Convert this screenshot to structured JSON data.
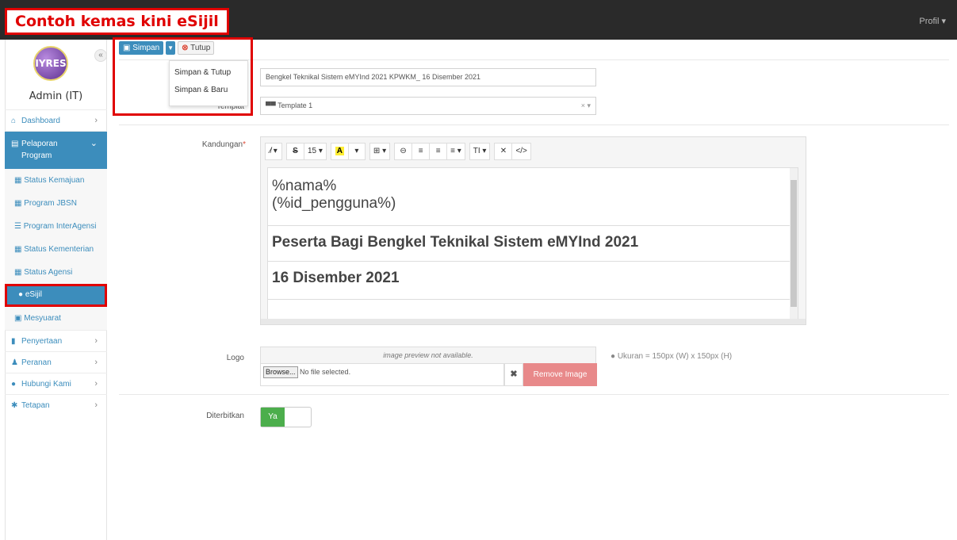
{
  "caption": "Contoh kemas kini eSijil",
  "topbar": {
    "profile": "Profil ▾"
  },
  "sidebar": {
    "collapse": "«",
    "logo_text": "IYRES",
    "admin": "Admin (IT)",
    "items": [
      {
        "label": "Dashboard",
        "icon": "home-icon"
      },
      {
        "label": "Pelaporan Program",
        "icon": "report-icon"
      },
      {
        "label": "Penyertaan",
        "icon": "clipboard-icon"
      },
      {
        "label": "Peranan",
        "icon": "user-icon"
      },
      {
        "label": "Hubungi Kami",
        "icon": "chat-icon"
      },
      {
        "label": "Tetapan",
        "icon": "gear-icon"
      }
    ],
    "sub_items": [
      {
        "label": "Status Kemajuan",
        "icon": "table-icon"
      },
      {
        "label": "Program JBSN",
        "icon": "table-icon"
      },
      {
        "label": "Program InterAgensi",
        "icon": "list-icon"
      },
      {
        "label": "Status Kementerian",
        "icon": "table-icon"
      },
      {
        "label": "Status Agensi",
        "icon": "table-icon"
      },
      {
        "label": "eSijil",
        "icon": "circle-icon"
      },
      {
        "label": "Mesyuarat",
        "icon": "calendar-icon"
      }
    ]
  },
  "toolbar": {
    "simpan": "Simpan",
    "tutup": "Tutup",
    "menu": [
      "Simpan & Tutup",
      "Simpan & Baru"
    ]
  },
  "form": {
    "title_value": "Bengkel Teknikal Sistem eMYInd 2021 KPWKM_ 16 Disember 2021",
    "template_label": "Templat",
    "template_value": "Template 1",
    "template_clear": "× ▾",
    "kandungan_label": "Kandungan",
    "required_mark": "*",
    "editor_toolbar": [
      "⁄̸ ▾",
      "S",
      "15 ▾",
      "A",
      "▾",
      "⊞ ▾",
      "⊖",
      "≡",
      "≡",
      "≡ ▾",
      "TI ▾",
      "✕",
      "</>"
    ],
    "content": {
      "line1": "%nama%",
      "line2": "(%id_pengguna%)",
      "line3": "Peserta Bagi Bengkel Teknikal Sistem eMYInd 2021",
      "line4": "16 Disember 2021"
    },
    "logo_label": "Logo",
    "preview_text": "image preview not available.",
    "browse": "Browse...",
    "no_file": "No file selected.",
    "clear": "✖",
    "remove_image": "Remove Image",
    "size_hint": "Ukuran = 150px (W) x 150px (H)",
    "diterbitkan_label": "Diterbitkan",
    "toggle_on": "Ya"
  },
  "colors": {
    "accent": "#3c8dbc",
    "highlight": "#e00000",
    "success": "#4cae4c",
    "danger": "#e8898a"
  }
}
